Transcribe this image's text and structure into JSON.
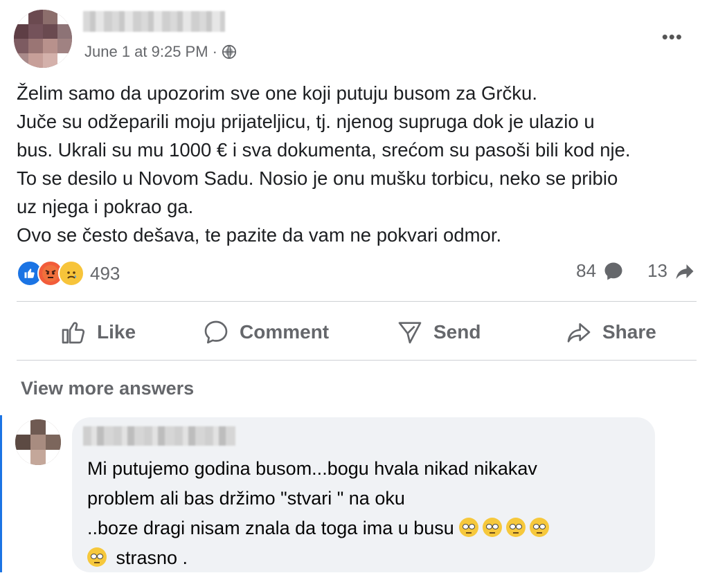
{
  "post": {
    "timestamp": "June 1 at 9:25 PM",
    "separator": "·",
    "privacy_icon": "globe-icon",
    "more_icon": "more-horizontal-icon",
    "more_label": "•••",
    "lines": [
      "Želim samo da upozorim sve one  koji putuju busom za Grčku.",
      "Juče su odžeparili moju prijateljicu, tj. njenog supruga dok je ulazio u",
      "bus. Ukrali su mu 1000 € i sva dokumenta, srećom su pasoši bili kod nje.",
      "To se desilo u Novom Sadu. Nosio je onu mušku torbicu, neko se pribio",
      "uz njega i pokrao ga.",
      "Ovo se često dešava, te  pazite da vam ne pokvari odmor."
    ]
  },
  "reactions": {
    "types": [
      "like",
      "angry",
      "sad"
    ],
    "count": "493",
    "comments_count": "84",
    "shares_count": "13"
  },
  "actions": {
    "like": "Like",
    "comment": "Comment",
    "send": "Send",
    "share": "Share"
  },
  "comments": {
    "view_more": "View more answers",
    "items": [
      {
        "line1": "Mi putujemo godina busom...bogu hvala nikad nikakav",
        "line2": "problem ali bas držimo \"stvari \" na oku",
        "line3": "..boze dragi nisam znala da toga ima u busu",
        "line4": "strasno ."
      }
    ]
  },
  "colors": {
    "accent": "#1b74e4",
    "secondary_text": "#65676b",
    "bubble": "#f0f2f5"
  }
}
